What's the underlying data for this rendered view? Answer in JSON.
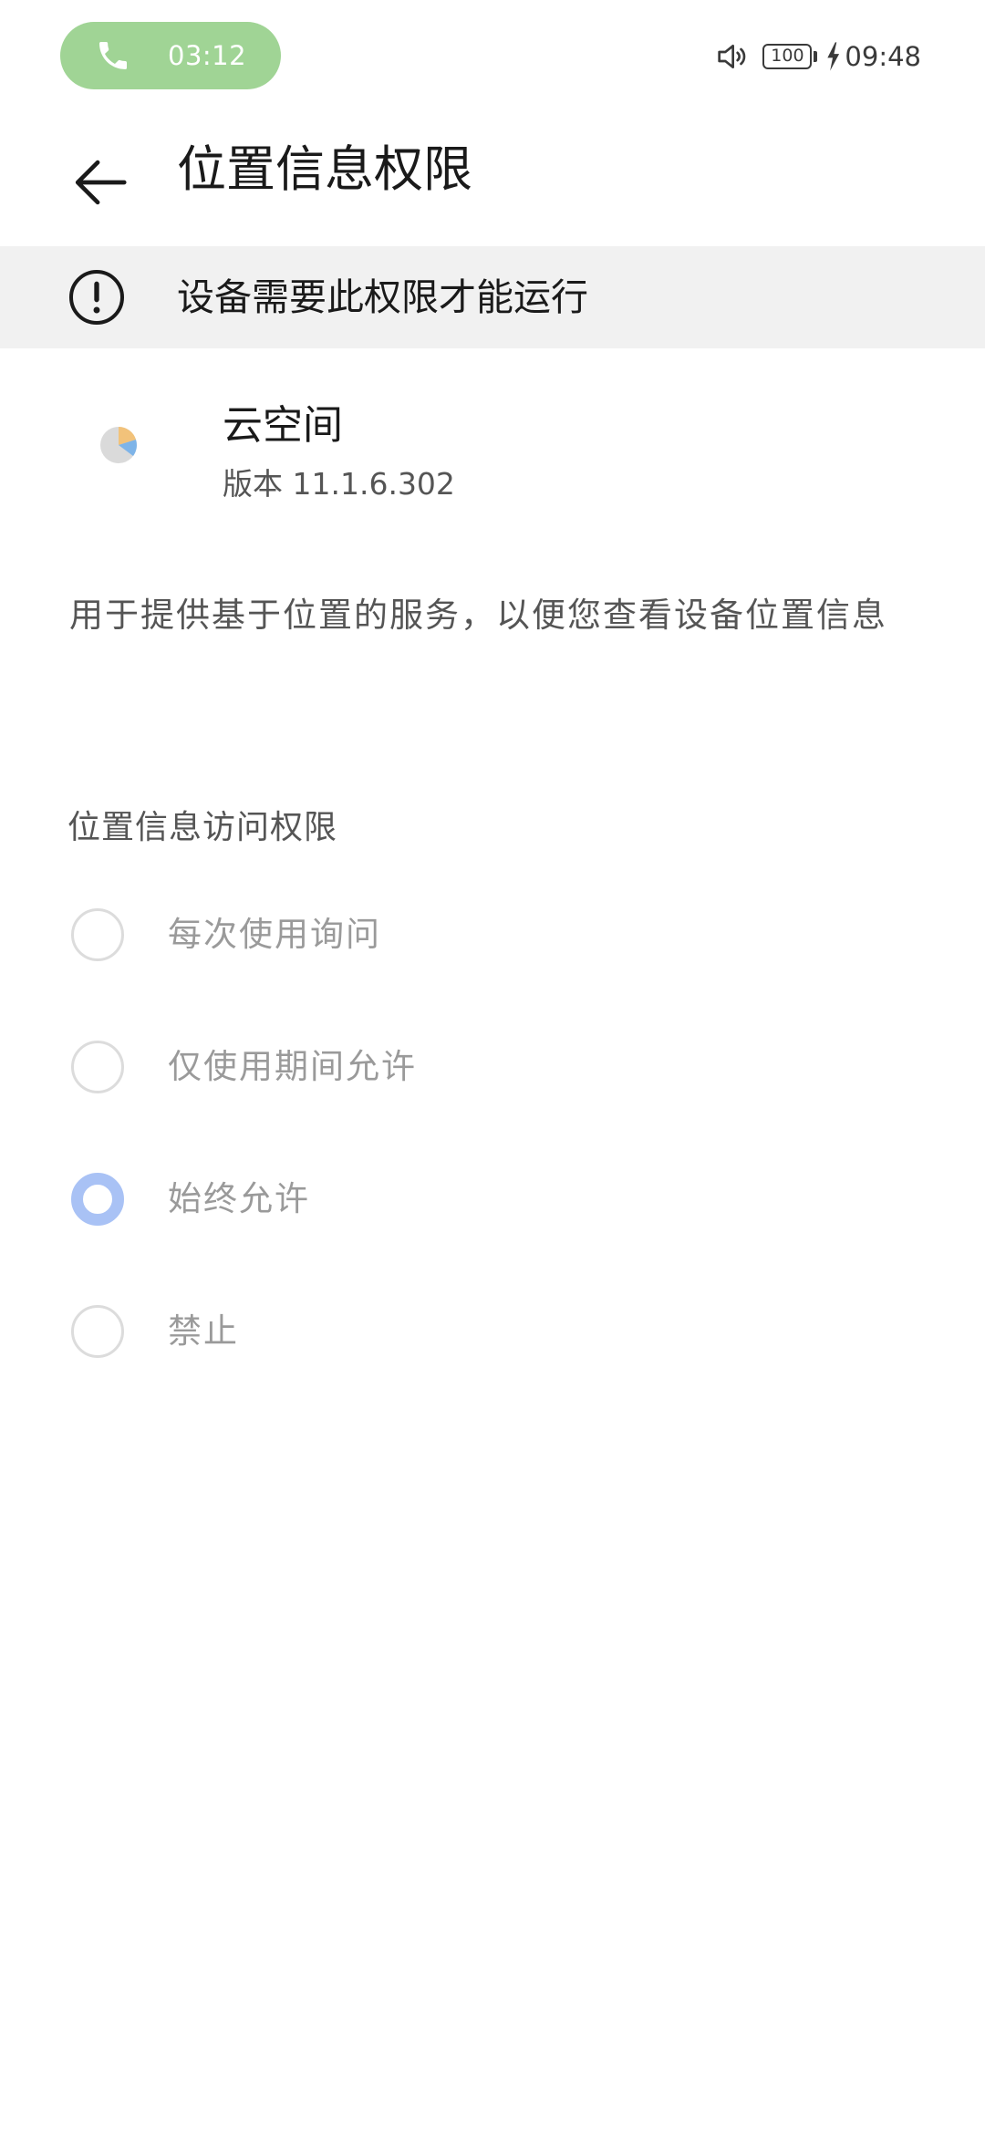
{
  "status_bar": {
    "call_duration": "03:12",
    "battery_level": "100",
    "time": "09:48",
    "call_pill_color": "#a0d495"
  },
  "header": {
    "title": "位置信息权限"
  },
  "warning": {
    "text": "设备需要此权限才能运行"
  },
  "app": {
    "name": "云空间",
    "version": "版本 11.1.6.302"
  },
  "description": "用于提供基于位置的服务，以便您查看设备位置信息",
  "access": {
    "header": "位置信息访问权限",
    "options": [
      {
        "label": "每次使用询问",
        "selected": false
      },
      {
        "label": "仅使用期间允许",
        "selected": false
      },
      {
        "label": "始终允许",
        "selected": true
      },
      {
        "label": "禁止",
        "selected": false
      }
    ],
    "selected_color": "#a9c2f5"
  },
  "icons": {
    "call": "phone-icon",
    "speaker": "speaker-icon",
    "charge": "charging-bolt-icon",
    "back": "back-arrow-icon",
    "warning": "exclamation-circle-icon",
    "app": "cloud-space-app-icon"
  }
}
